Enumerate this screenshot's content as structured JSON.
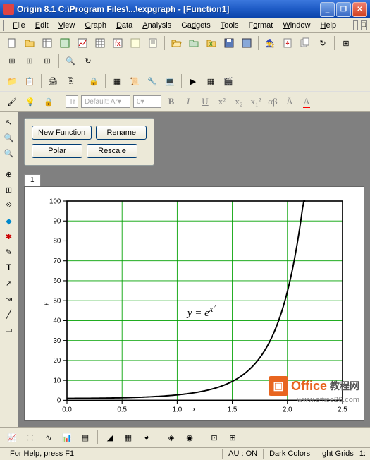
{
  "window": {
    "title": "Origin 8.1 C:\\Program Files\\...\\expgraph - [Function1]"
  },
  "menu": [
    "File",
    "Edit",
    "View",
    "Graph",
    "Data",
    "Analysis",
    "Gadgets",
    "Tools",
    "Format",
    "Window",
    "Help"
  ],
  "fontToolbar": {
    "font": "Default: Ar",
    "size": "0"
  },
  "fnPanel": {
    "newFunction": "New Function",
    "rename": "Rename",
    "polar": "Polar",
    "rescale": "Rescale"
  },
  "tab": "1",
  "chart_data": {
    "type": "line",
    "title": "",
    "xlabel": "x",
    "ylabel": "y",
    "xlim": [
      0.0,
      2.5
    ],
    "ylim": [
      0,
      100
    ],
    "xticks": [
      0.0,
      0.5,
      1.0,
      1.5,
      2.0,
      2.5
    ],
    "yticks": [
      0,
      10,
      20,
      30,
      40,
      50,
      60,
      70,
      80,
      90,
      100
    ],
    "equation": "y = e^(x^2)",
    "x": [
      0.0,
      0.25,
      0.5,
      0.75,
      1.0,
      1.25,
      1.5,
      1.75,
      2.0,
      2.1,
      2.15
    ],
    "values": [
      1.0,
      1.06,
      1.28,
      1.76,
      2.72,
      4.77,
      9.49,
      21.4,
      54.6,
      82.3,
      101.9
    ],
    "grid_color": "#00a000",
    "curve_color": "#000000"
  },
  "status": {
    "help": "For Help, press F1",
    "au": "AU : ON",
    "colors": "Dark Colors",
    "grids": "ght Grids",
    "extra": "1:"
  },
  "watermark": {
    "t1": "Office",
    "t2": "教程网",
    "url": "www.office26.com"
  }
}
